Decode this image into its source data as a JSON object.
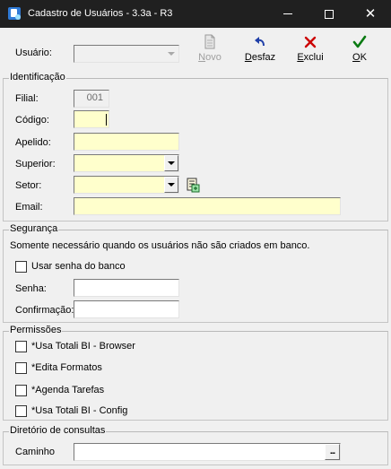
{
  "window": {
    "title": "Cadastro de Usuários - 3.3a - R3",
    "minimize_glyph": "—",
    "close_glyph": "✕"
  },
  "toolbar": {
    "usuario_label": "Usuário:",
    "usuario_value": "",
    "novo": {
      "text": "Novo",
      "key": "N",
      "rest": "ovo",
      "icon": "new-document-icon",
      "enabled": false
    },
    "desfaz": {
      "text": "Desfaz",
      "key": "D",
      "rest": "esfaz",
      "icon": "undo-arrow-icon"
    },
    "exclui": {
      "text": "Exclui",
      "key": "E",
      "rest": "xclui",
      "icon": "red-x-icon"
    },
    "ok": {
      "text": "OK",
      "key": "O",
      "rest": "K",
      "icon": "green-checkmark-icon"
    }
  },
  "identificacao": {
    "legend": "Identificação",
    "filial_label": "Filial:",
    "filial_value": "001",
    "codigo_label": "Código:",
    "codigo_value": "",
    "apelido_label": "Apelido:",
    "apelido_value": "",
    "superior_label": "Superior:",
    "superior_value": "",
    "setor_label": "Setor:",
    "setor_value": "",
    "email_label": "Email:",
    "email_value": ""
  },
  "seguranca": {
    "legend": "Segurança",
    "note": "Somente necessário quando os usuários não são criados em banco.",
    "usar_senha_label": "Usar senha do banco",
    "usar_senha_checked": false,
    "senha_label": "Senha:",
    "senha_value": "",
    "confirmacao_label": "Confirmação:",
    "confirmacao_value": ""
  },
  "permissoes": {
    "legend": "Permissões",
    "items": [
      {
        "label": "*Usa Totali BI - Browser",
        "checked": false
      },
      {
        "label": "*Edita Formatos",
        "checked": false
      },
      {
        "label": "*Agenda Tarefas",
        "checked": false
      },
      {
        "label": "*Usa Totali BI - Config",
        "checked": false
      }
    ]
  },
  "diretorio": {
    "legend": "Diretório de consultas",
    "caminho_label": "Caminho",
    "caminho_value": "",
    "browse_label": "..."
  },
  "colors": {
    "titlebar_bg": "#202020",
    "field_required_bg": "#ffffcc",
    "window_bg": "#f0f0f0",
    "undo_icon": "#1f3fa8",
    "delete_icon": "#cc0000",
    "ok_icon": "#0a7a12"
  }
}
